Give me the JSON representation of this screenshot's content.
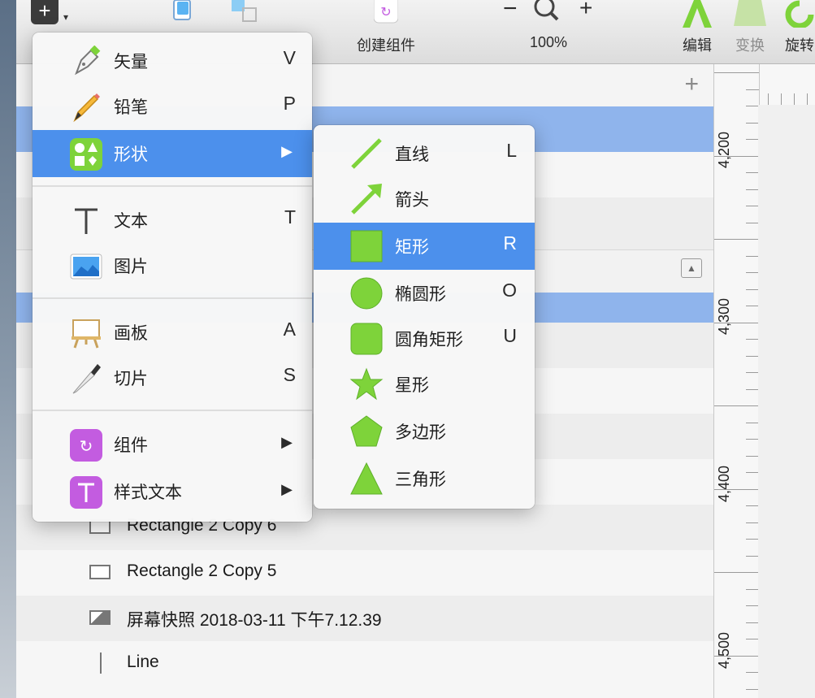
{
  "toolbar": {
    "insert_symbol": "+",
    "create_symbol_label": "创建组件",
    "zoom_minus": "−",
    "zoom_plus": "+",
    "zoom_level": "100%",
    "edit_label": "编辑",
    "transform_label": "变换",
    "rotate_label": "旋转"
  },
  "layers": {
    "add_symbol": "+",
    "rows": [
      {
        "name": "Rectangle 2 Copy 6",
        "icon": "rectangle-icon"
      },
      {
        "name": "Rectangle 2 Copy 5",
        "icon": "rectangle-icon"
      },
      {
        "name": "屏幕快照 2018-03-11 下午7.12.39",
        "icon": "image-icon"
      },
      {
        "name": "Line",
        "icon": "line-icon"
      }
    ]
  },
  "ruler": {
    "labels": [
      "4,200",
      "4,300",
      "4,400",
      "4,500"
    ]
  },
  "insert_menu": {
    "items": [
      {
        "label": "矢量",
        "shortcut": "V",
        "icon": "vector-pen-icon"
      },
      {
        "label": "铅笔",
        "shortcut": "P",
        "icon": "pencil-icon"
      },
      {
        "label": "形状",
        "arrow": "▶",
        "icon": "shapes-icon",
        "highlighted": true
      },
      {
        "label": "文本",
        "shortcut": "T",
        "icon": "text-icon"
      },
      {
        "label": "图片",
        "icon": "image-icon"
      },
      {
        "label": "画板",
        "shortcut": "A",
        "icon": "artboard-icon"
      },
      {
        "label": "切片",
        "shortcut": "S",
        "icon": "slice-knife-icon"
      },
      {
        "label": "组件",
        "arrow": "▶",
        "icon": "symbol-icon"
      },
      {
        "label": "样式文本",
        "arrow": "▶",
        "icon": "styled-text-icon"
      }
    ]
  },
  "shape_menu": {
    "items": [
      {
        "label": "直线",
        "shortcut": "L",
        "icon": "line-shape-icon"
      },
      {
        "label": "箭头",
        "icon": "arrow-shape-icon"
      },
      {
        "label": "矩形",
        "shortcut": "R",
        "icon": "rectangle-shape-icon",
        "highlighted": true
      },
      {
        "label": "椭圆形",
        "shortcut": "O",
        "icon": "oval-shape-icon"
      },
      {
        "label": "圆角矩形",
        "shortcut": "U",
        "icon": "rounded-rectangle-shape-icon"
      },
      {
        "label": "星形",
        "icon": "star-shape-icon"
      },
      {
        "label": "多边形",
        "icon": "polygon-shape-icon"
      },
      {
        "label": "三角形",
        "icon": "triangle-shape-icon"
      }
    ]
  },
  "colors": {
    "highlight": "#4c90ec",
    "selection_row": "#8fb4ec",
    "shape_green": "#7ed33a",
    "symbol_purple": "#c35ce0"
  }
}
